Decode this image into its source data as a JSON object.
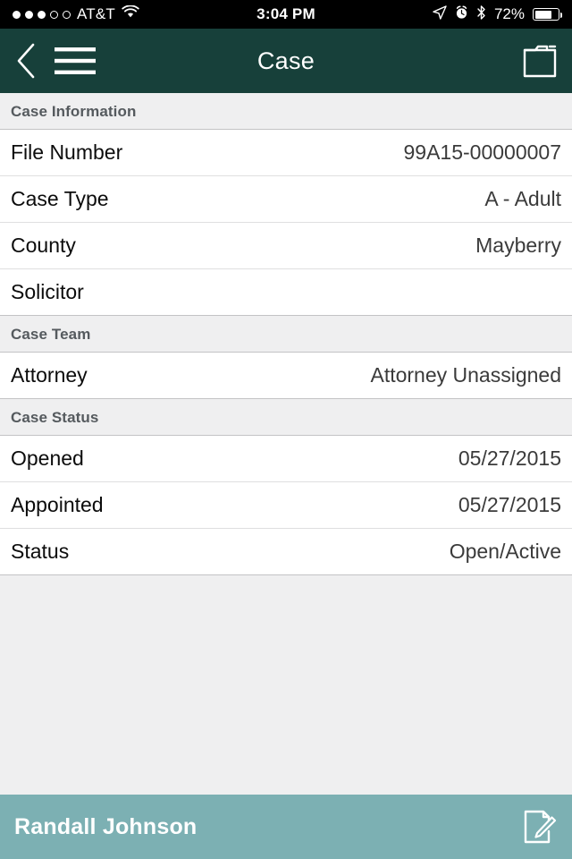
{
  "status_bar": {
    "carrier": "AT&T",
    "signal_dots_filled": 3,
    "signal_dots_total": 5,
    "wifi_icon": "wifi-icon",
    "time": "3:04 PM",
    "location_icon": "location-arrow-icon",
    "alarm_icon": "alarm-clock-icon",
    "bluetooth_icon": "bluetooth-icon",
    "battery_percent": "72%",
    "battery_level": 72
  },
  "navbar": {
    "back_icon": "chevron-left-icon",
    "menu_icon": "hamburger-menu-icon",
    "title": "Case",
    "action_icon": "case-folder-icon",
    "background_color": "#17403a"
  },
  "sections": [
    {
      "header": "Case Information",
      "rows": [
        {
          "label": "File Number",
          "value": "99A15-00000007"
        },
        {
          "label": "Case Type",
          "value": "A - Adult"
        },
        {
          "label": "County",
          "value": "Mayberry"
        },
        {
          "label": "Solicitor",
          "value": ""
        }
      ]
    },
    {
      "header": "Case Team",
      "rows": [
        {
          "label": "Attorney",
          "value": "Attorney Unassigned"
        }
      ]
    },
    {
      "header": "Case Status",
      "rows": [
        {
          "label": "Opened",
          "value": "05/27/2015"
        },
        {
          "label": "Appointed",
          "value": "05/27/2015"
        },
        {
          "label": "Status",
          "value": "Open/Active"
        }
      ]
    }
  ],
  "bottom_bar": {
    "name": "Randall Johnson",
    "edit_icon": "document-edit-icon",
    "background_color": "#7cb0b3"
  }
}
